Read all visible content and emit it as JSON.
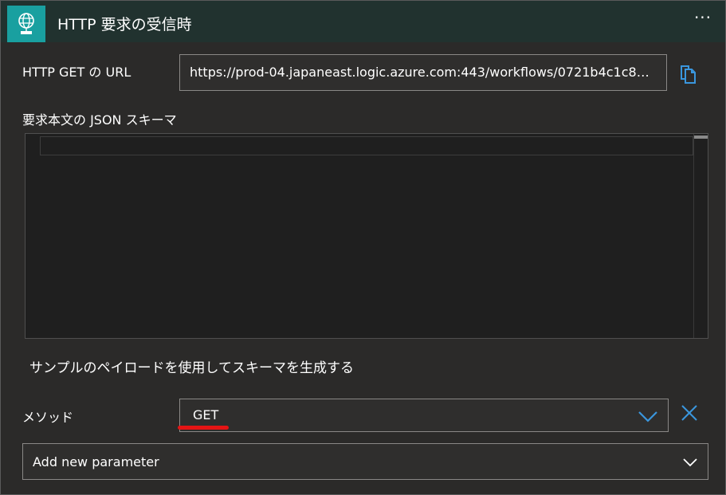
{
  "header": {
    "title": "HTTP 要求の受信時",
    "icon": "globe-http-icon",
    "accent_color": "#19a0a0",
    "more_label": "···"
  },
  "url_section": {
    "label": "HTTP GET の URL",
    "value": "https://prod-04.japaneast.logic.azure.com:443/workflows/0721b4c1c884...",
    "copy_icon": "copy-icon"
  },
  "schema_section": {
    "label": "要求本文の JSON スキーマ",
    "value": ""
  },
  "sample_link": "サンプルのペイロードを使用してスキーマを生成する",
  "method": {
    "label": "メソッド",
    "selected": "GET",
    "chevron_icon": "chevron-down-icon",
    "remove_icon": "close-icon"
  },
  "add_parameter": {
    "label": "Add new parameter",
    "chevron_icon": "chevron-down-icon"
  },
  "colors": {
    "link_blue": "#3a96dd",
    "annotation_red": "#e51414"
  }
}
